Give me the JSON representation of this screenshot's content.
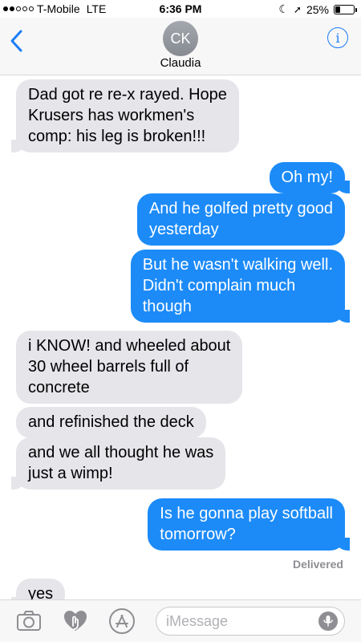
{
  "status_bar": {
    "carrier": "T-Mobile",
    "network": "LTE",
    "time": "6:36 PM",
    "battery": "25%",
    "battery_level": 0.25,
    "signal_bars_filled": 2,
    "signal_bars_total": 5
  },
  "header": {
    "avatar_initials": "CK",
    "contact_name": "Claudia",
    "back_icon": "chevron-left-icon",
    "info_icon": "info-icon",
    "info_glyph": "i"
  },
  "messages": [
    {
      "direction": "in",
      "text_lines": [
        "Dad got re re-x rayed. Hope",
        "Krusers has workmen's",
        "comp: his leg is broken!!!"
      ]
    },
    {
      "direction": "out",
      "text_lines": [
        "Oh my!"
      ]
    },
    {
      "direction": "out",
      "text_lines": [
        "And he golfed pretty good",
        "yesterday"
      ]
    },
    {
      "direction": "out",
      "text_lines": [
        "But he wasn't walking well.",
        "Didn't complain much",
        "though"
      ]
    },
    {
      "direction": "in",
      "text_lines": [
        "i KNOW! and wheeled about",
        "30 wheel barrels full of",
        "concrete"
      ]
    },
    {
      "direction": "in",
      "text_lines": [
        "and refinished the deck"
      ]
    },
    {
      "direction": "in",
      "text_lines": [
        "and we all thought he was",
        "just a wimp!"
      ]
    },
    {
      "direction": "out",
      "text_lines": [
        "Is he gonna play softball",
        "tomorrow?"
      ]
    },
    {
      "direction": "in",
      "text_lines": [
        "yes"
      ]
    }
  ],
  "delivered_label": "Delivered",
  "input_bar": {
    "placeholder": "iMessage",
    "icons": [
      "camera-icon",
      "digital-touch-icon",
      "app-store-icon",
      "microphone-icon"
    ]
  },
  "colors": {
    "outgoing_bubble": "#1c8bf8",
    "incoming_bubble": "#e5e5ea",
    "accent": "#1b7cf7"
  }
}
